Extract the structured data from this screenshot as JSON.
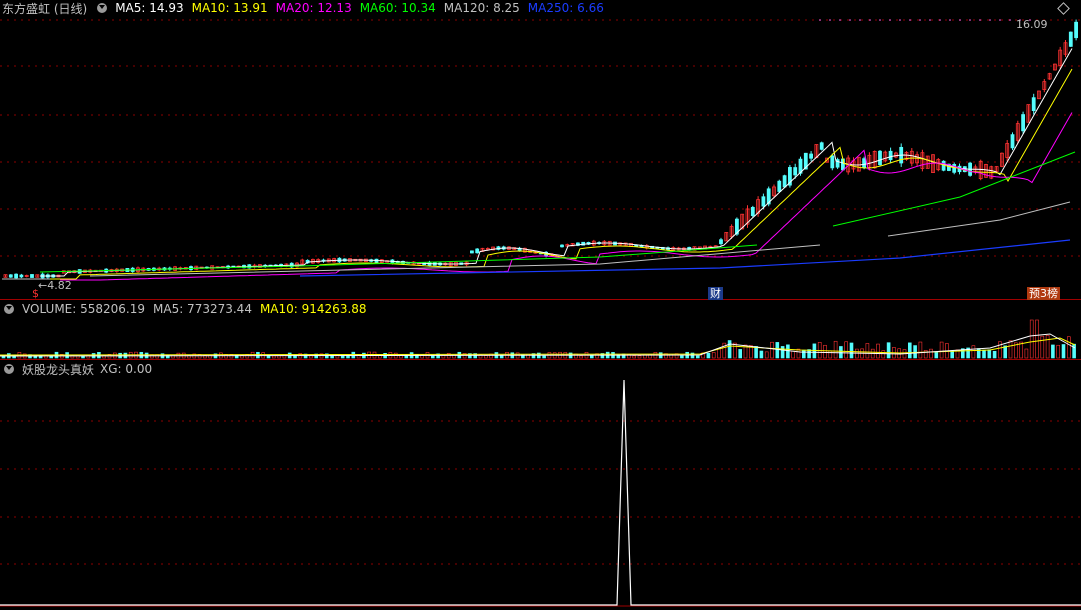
{
  "main": {
    "title": "东方盛虹 (日线)",
    "ma": [
      {
        "label": "MA5: 14.93",
        "color": "#ffffff"
      },
      {
        "label": "MA10: 13.91",
        "color": "#ffff00"
      },
      {
        "label": "MA20: 12.13",
        "color": "#ff00ff"
      },
      {
        "label": "MA60: 10.34",
        "color": "#00ff00"
      },
      {
        "label": "MA120: 8.25",
        "color": "#c0c0c0"
      },
      {
        "label": "MA250: 6.66",
        "color": "#1a3cff"
      }
    ],
    "high_label": "16.09",
    "low_label": "←4.82",
    "tag_cai": "财",
    "tag_yu": "预3榜",
    "marker": "$"
  },
  "volume": {
    "items": [
      {
        "label": "VOLUME: 558206.19",
        "color": "#c0c0c0"
      },
      {
        "label": "MA5: 773273.44",
        "color": "#c0c0c0"
      },
      {
        "label": "MA10: 914263.88",
        "color": "#ffff00"
      }
    ]
  },
  "indicator": {
    "title": "妖股龙头真妖",
    "xg": "XG: 0.00"
  },
  "colors": {
    "up": "#ff3232",
    "down": "#54fcfc",
    "grid": "#8b0000"
  }
}
